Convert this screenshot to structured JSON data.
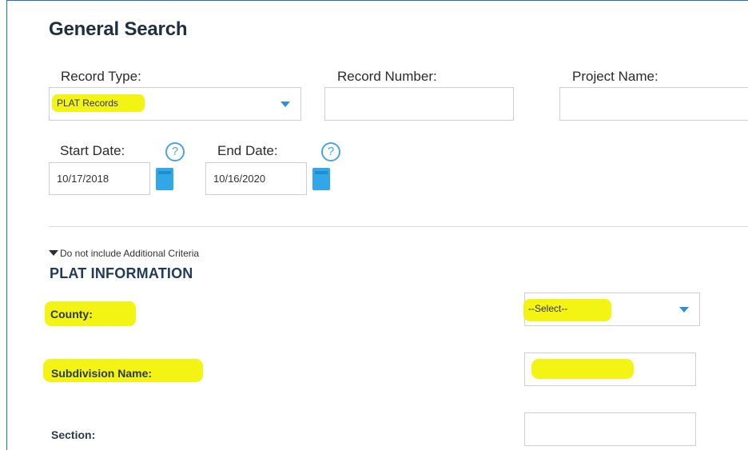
{
  "title": "General Search",
  "record_type": {
    "label": "Record Type:",
    "selected": "PLAT Records"
  },
  "record_number": {
    "label": "Record Number:",
    "value": ""
  },
  "project_name": {
    "label": "Project Name:",
    "value": ""
  },
  "start_date": {
    "label": "Start Date:",
    "value": "10/17/2018",
    "help_symbol": "?"
  },
  "end_date": {
    "label": "End Date:",
    "value": "10/16/2020",
    "help_symbol": "?"
  },
  "additional_criteria_toggle": "Do not include Additional Criteria",
  "plat_information": {
    "heading": "PLAT INFORMATION",
    "county": {
      "label": "County:",
      "selected": "--Select--"
    },
    "subdivision_name": {
      "label": "Subdivision Name:",
      "value": ""
    },
    "section": {
      "label": "Section:",
      "value": ""
    }
  },
  "colors": {
    "highlight": "#f3f300",
    "accent_blue": "#2f8de4",
    "frame_border": "#2d6fb6"
  },
  "icons": {
    "help": "help-circle-icon",
    "calendar": "calendar-icon",
    "dropdown": "chevron-down-icon",
    "expand": "triangle-down-icon"
  }
}
